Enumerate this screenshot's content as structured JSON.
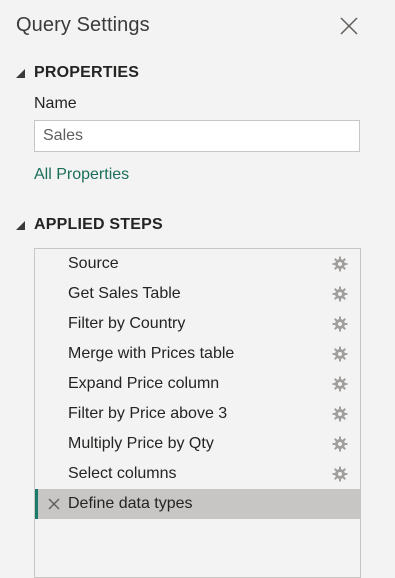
{
  "pane": {
    "title": "Query Settings",
    "close_icon": "close-icon"
  },
  "properties": {
    "header": "PROPERTIES",
    "name_label": "Name",
    "name_value": "Sales",
    "all_properties_link": "All Properties"
  },
  "applied_steps": {
    "header": "APPLIED STEPS",
    "steps": [
      {
        "label": "Source",
        "selected": false
      },
      {
        "label": "Get Sales Table",
        "selected": false
      },
      {
        "label": "Filter by Country",
        "selected": false
      },
      {
        "label": "Merge with Prices table",
        "selected": false
      },
      {
        "label": "Expand Price column",
        "selected": false
      },
      {
        "label": "Filter by Price above 3",
        "selected": false
      },
      {
        "label": "Multiply Price by Qty",
        "selected": false
      },
      {
        "label": "Select columns",
        "selected": false
      },
      {
        "label": "Define data types",
        "selected": true
      }
    ]
  },
  "colors": {
    "accent": "#1a7b6b",
    "link": "#1a6e5a",
    "selected_row": "#c8c6c4"
  }
}
